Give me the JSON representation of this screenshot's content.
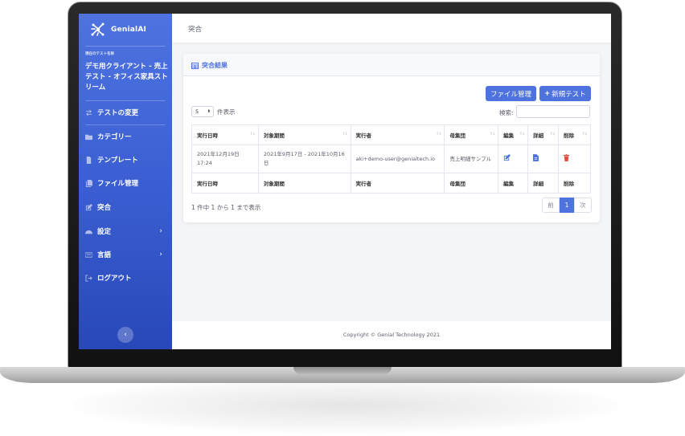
{
  "sidebar": {
    "brand": "GenialAI",
    "current_test_label": "現在のテスト名称",
    "current_test_name": "デモ用クライアント - 売上テスト - オフィス家具ストリーム",
    "items": [
      {
        "label": "テストの変更"
      },
      {
        "label": "カテゴリー"
      },
      {
        "label": "テンプレート"
      },
      {
        "label": "ファイル管理"
      },
      {
        "label": "突合"
      },
      {
        "label": "設定"
      },
      {
        "label": "言語"
      },
      {
        "label": "ログアウト"
      }
    ],
    "toggle_glyph": "‹"
  },
  "topbar": {
    "title": "突合"
  },
  "card": {
    "title": "突合結果",
    "buttons": {
      "file_manage": "ファイル管理",
      "new_test": "新規テスト"
    },
    "length_value": "5",
    "length_suffix": "件表示",
    "search_label": "検索:",
    "search_value": "",
    "columns": [
      "実行日時",
      "対象期間",
      "実行者",
      "母集団",
      "編集",
      "詳細",
      "削除"
    ],
    "rows": [
      {
        "executed_at": "2021年12月19日 17:24",
        "period": "2021年9月17日 - 2021年10月16日",
        "executor": "aki+demo-user@genialtech.io",
        "population": "売上明細サンプル",
        "edit_icon": "edit-icon",
        "detail_icon": "file-icon",
        "delete_icon": "trash-icon"
      }
    ],
    "info": "1 件中 1 から 1 まで表示",
    "pagination": {
      "prev": "前",
      "current": "1",
      "next": "次"
    }
  },
  "footer": {
    "copyright": "Copyright © Genial Technology 2021"
  },
  "colors": {
    "primary": "#4e73df",
    "danger": "#e74a3b",
    "sidebar_dark": "#2848b8"
  }
}
